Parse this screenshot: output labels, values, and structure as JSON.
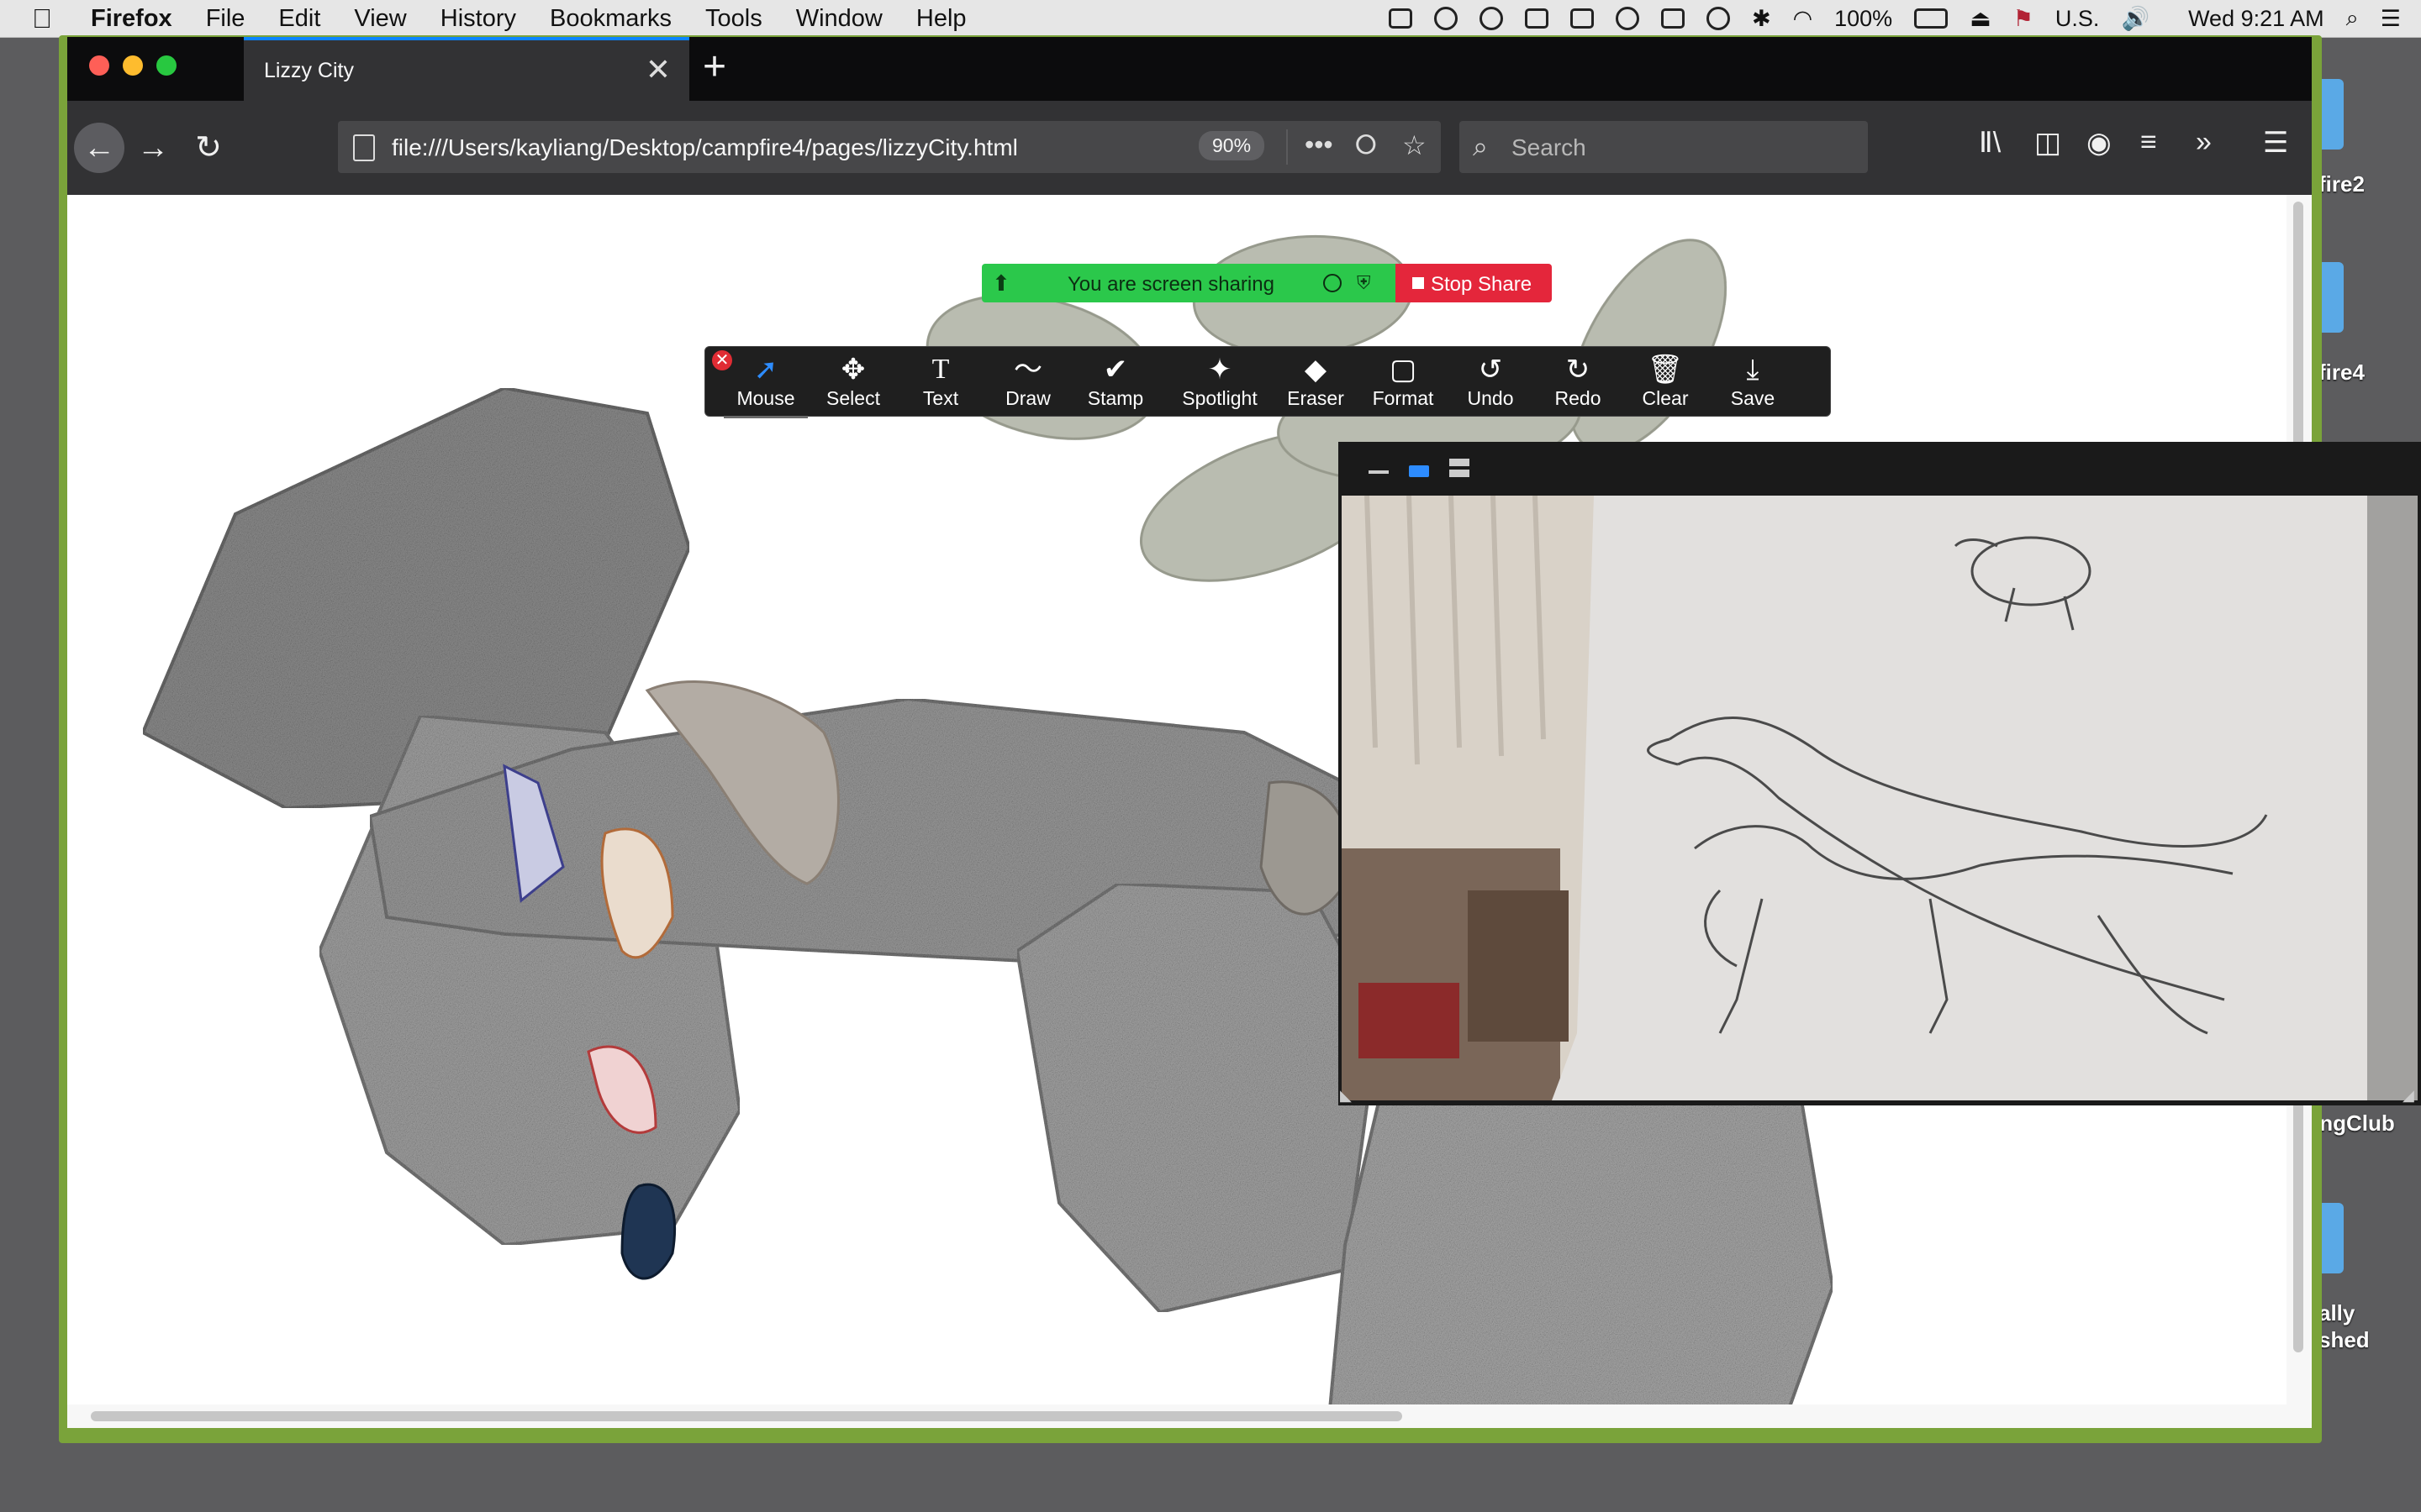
{
  "menubar": {
    "app_name": "Firefox",
    "items": [
      "File",
      "Edit",
      "View",
      "History",
      "Bookmarks",
      "Tools",
      "Window",
      "Help"
    ],
    "battery": "100%",
    "input_source": "U.S.",
    "clock": "Wed 9:21 AM",
    "status_icons": [
      "zoom-icon",
      "creative-cloud-icon",
      "menu-extra-icon",
      "display-icon",
      "screen-mirror-icon",
      "dnd-icon",
      "airplay-icon",
      "time-machine-icon",
      "bluetooth-icon",
      "wifi-icon",
      "battery-icon",
      "eject-icon",
      "flag-icon",
      "volume-icon",
      "spotlight-icon",
      "notification-center-icon"
    ]
  },
  "desktop": {
    "labels": [
      "fire2",
      "fire4",
      "ingClub",
      "ally",
      "shed"
    ]
  },
  "browser": {
    "tab_title": "Lizzy City",
    "url": "file:///Users/kayliang/Desktop/campfire4/pages/lizzyCity.html",
    "zoom": "90%",
    "search_placeholder": "Search"
  },
  "zoom_share": {
    "banner_text": "You are screen sharing",
    "stop_label": "Stop Share"
  },
  "annotation_toolbar": {
    "tools": [
      {
        "label": "Mouse",
        "icon": "pointer-icon",
        "glyph": "➚"
      },
      {
        "label": "Select",
        "icon": "move-icon",
        "glyph": "✥"
      },
      {
        "label": "Text",
        "icon": "text-icon",
        "glyph": "T"
      },
      {
        "label": "Draw",
        "icon": "draw-icon",
        "glyph": "〜"
      },
      {
        "label": "Stamp",
        "icon": "checkmark-icon",
        "glyph": "✔"
      },
      {
        "label": "Spotlight",
        "icon": "spotlight-icon",
        "glyph": "✦"
      },
      {
        "label": "Eraser",
        "icon": "eraser-icon",
        "glyph": "◆"
      },
      {
        "label": "Format",
        "icon": "format-icon",
        "glyph": "▢"
      },
      {
        "label": "Undo",
        "icon": "undo-icon",
        "glyph": "↺"
      },
      {
        "label": "Redo",
        "icon": "redo-icon",
        "glyph": "↻"
      },
      {
        "label": "Clear",
        "icon": "trash-icon",
        "glyph": "🗑"
      },
      {
        "label": "Save",
        "icon": "save-icon",
        "glyph": "⤓"
      }
    ],
    "active_tool": "Mouse"
  },
  "colors": {
    "accent": "#0a84ff",
    "share_green": "#2bc84b",
    "stop_red": "#e4263b",
    "window_border": "#7aa33a",
    "zoom_blue": "#2d8cff"
  }
}
